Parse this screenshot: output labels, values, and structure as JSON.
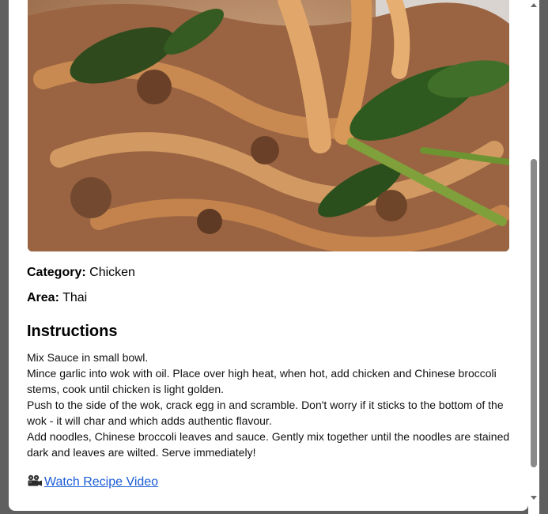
{
  "meal": {
    "image_alt": "Pad See Ew",
    "category_label": "Category:",
    "category_value": "Chicken",
    "area_label": "Area:",
    "area_value": "Thai",
    "instructions_heading": "Instructions",
    "instructions": [
      "Mix Sauce in small bowl.",
      "Mince garlic into wok with oil. Place over high heat, when hot, add chicken and Chinese broccoli stems, cook until chicken is light golden.",
      "Push to the side of the wok, crack egg in and scramble. Don't worry if it sticks to the bottom of the wok - it will char and which adds authentic flavour.",
      "Add noodles, Chinese broccoli leaves and sauce. Gently mix together until the noodles are stained dark and leaves are wilted. Serve immediately!"
    ],
    "video_link_label": "Watch Recipe Video",
    "video_icon": "film-projector-icon"
  },
  "scrollbar": {
    "position_fraction": 0.86
  },
  "colors": {
    "link": "#1a5cd6",
    "backdrop": "#5f5f5f",
    "card": "#ffffff",
    "scroll_thumb": "#8a8a8a"
  }
}
